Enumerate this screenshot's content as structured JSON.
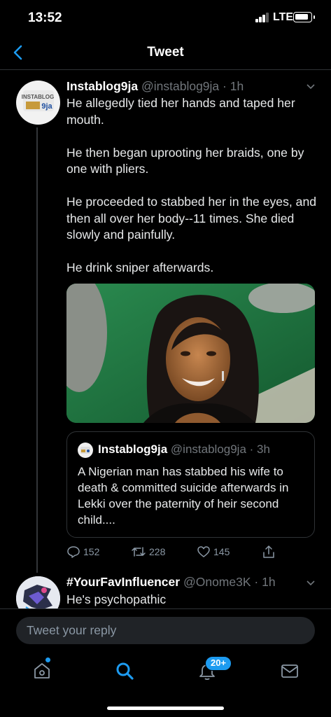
{
  "status_bar": {
    "time": "13:52",
    "network": "LTE"
  },
  "nav": {
    "title": "Tweet"
  },
  "tweet": {
    "name": "Instablog9ja",
    "handle": "@instablog9ja",
    "time": "1h",
    "paragraphs": [
      "He allegedly tied her hands and taped her mouth.",
      "He then began uprooting her braids, one by one with pliers.",
      "He proceeded to stabbed her in the eyes, and then all over her body--11 times. She died slowly and painfully.",
      "He drink sniper afterwards."
    ],
    "avatar_text": "INSTABLOG 9ja"
  },
  "quote": {
    "name": "Instablog9ja",
    "handle": "@instablog9ja",
    "time": "3h",
    "text": "A Nigerian man has stabbed his wife to death & committed suicide afterwards in Lekki over the paternity of heir second child...."
  },
  "actions": {
    "replies": "152",
    "retweets": "228",
    "likes": "145"
  },
  "reply_tweet": {
    "name": "#YourFavInfluencer",
    "handle": "@Onome3K",
    "time": "1h",
    "text": "He's psychopathic"
  },
  "reply_box": {
    "placeholder": "Tweet your reply"
  },
  "tab_bar": {
    "notifications_badge": "20+"
  },
  "colors": {
    "accent": "#1d9bf0",
    "background": "#000000",
    "secondary_text": "#71767b"
  }
}
